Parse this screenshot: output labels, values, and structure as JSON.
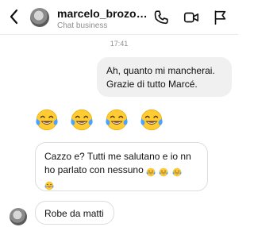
{
  "header": {
    "name": "marcelo_brozo…",
    "subtitle": "Chat business",
    "icons": [
      "back-chevron-icon",
      "phone-icon",
      "video-icon",
      "flag-icon"
    ]
  },
  "thread": {
    "timestamp": "17:41",
    "messages": [
      {
        "direction": "outgoing",
        "line1": "Ah, quanto mi mancherai.",
        "line2": "Grazie di tutto Marcé."
      },
      {
        "direction": "incoming",
        "emoji": "face-with-tears-of-joy",
        "emoji_count": 4
      },
      {
        "direction": "incoming",
        "line1": "Cazzo e? Tutti me salutano e io nn",
        "line2": "ho parlato con nessuno",
        "trailing_emoji": "face-with-tears-of-joy"
      },
      {
        "direction": "incoming",
        "text": "Robe da matti"
      }
    ]
  },
  "colors": {
    "outgoing_bubble": "#f0f0f0",
    "incoming_border": "#dcdcdc",
    "secondary_text": "#8e8e8e",
    "emoji_face": "#ffcc33",
    "emoji_tears": "#4aa3ff"
  }
}
